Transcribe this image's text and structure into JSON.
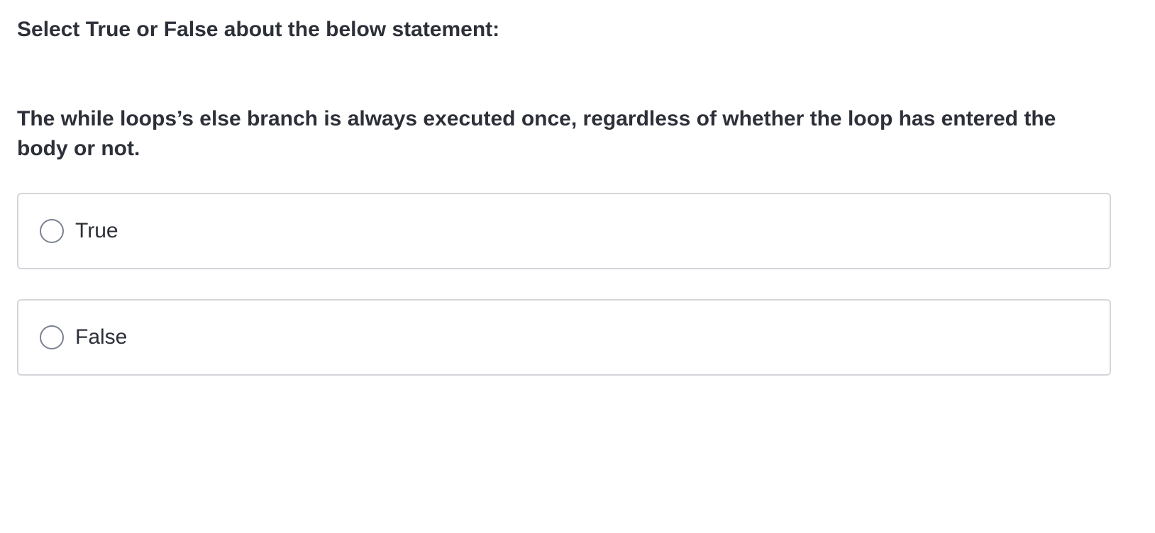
{
  "question": {
    "instruction": "Select True or False about the below statement:",
    "statement": "The while loops’s else branch is always executed once, regardless of whether the loop has entered the body or not.",
    "options": [
      {
        "label": "True",
        "selected": false
      },
      {
        "label": "False",
        "selected": false
      }
    ]
  },
  "colors": {
    "text": "#2d3039",
    "border": "#d4d6da",
    "radio_border": "#7b8190",
    "background": "#ffffff"
  }
}
